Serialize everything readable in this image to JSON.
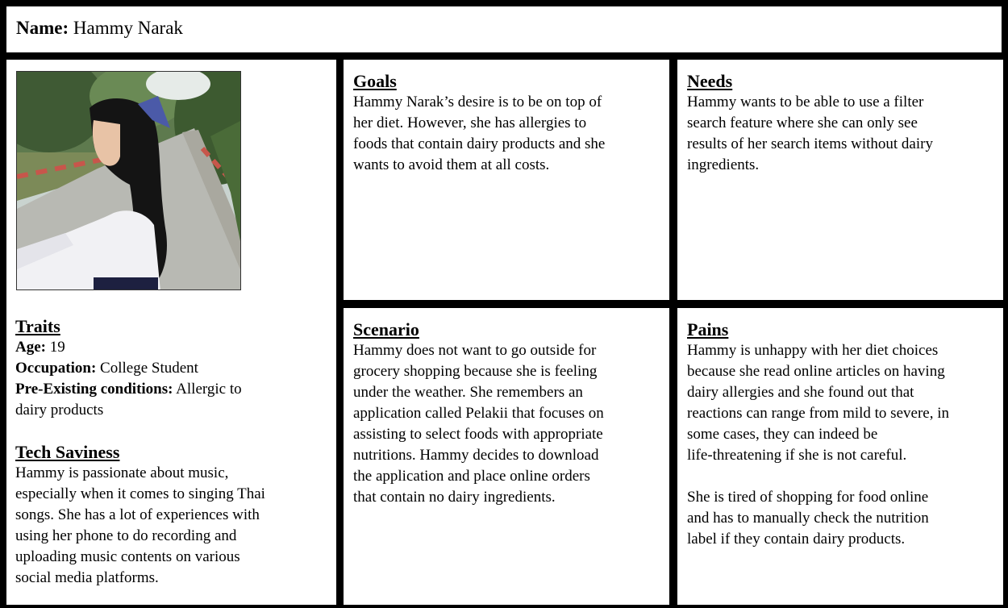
{
  "header": {
    "name_label": "Name:",
    "name_value": "Hammy Narak"
  },
  "traits": {
    "title": "Traits",
    "age_label": "Age:",
    "age_value": "19",
    "occupation_label": "Occupation:",
    "occupation_value": "College Student",
    "conditions_label": "Pre-Existing conditions:",
    "conditions_value_line1": "Allergic to",
    "conditions_value_line2": "dairy products"
  },
  "tech": {
    "title": "Tech Saviness",
    "lines": [
      "Hammy is passionate about music,",
      "especially when it comes to singing Thai",
      "songs. She has a lot of experiences with",
      "using her phone to do recording and",
      "uploading music contents on various",
      "social media platforms."
    ]
  },
  "goals": {
    "title": "Goals",
    "lines": [
      "Hammy Narak’s desire is to be on top of",
      "her diet. However, she has allergies to",
      "foods that contain dairy products and she",
      "wants to avoid them at all costs."
    ]
  },
  "needs": {
    "title": "Needs",
    "lines": [
      "Hammy wants to be able to use a filter",
      "search feature where she can only see",
      "results of her search items without dairy",
      "ingredients."
    ]
  },
  "scenario": {
    "title": "Scenario",
    "lines": [
      "Hammy does not want to go outside for",
      "grocery shopping because she is feeling",
      "under the weather. She remembers an",
      "application called Pelakii that focuses on",
      "assisting to select foods with appropriate",
      "nutritions. Hammy decides to download",
      "the application and place online orders",
      "that contain no dairy ingredients."
    ]
  },
  "pains": {
    "title": "Pains",
    "para1": [
      "Hammy is unhappy with her diet choices",
      "because she read online articles on having",
      "dairy allergies and she found out that",
      "reactions can range from mild to severe, in",
      "some cases, they can indeed be",
      "life-threatening if she is not careful."
    ],
    "para2": [
      "She is tired of shopping for food online",
      "and has to manually check the nutrition",
      "label if they contain dairy products."
    ]
  }
}
